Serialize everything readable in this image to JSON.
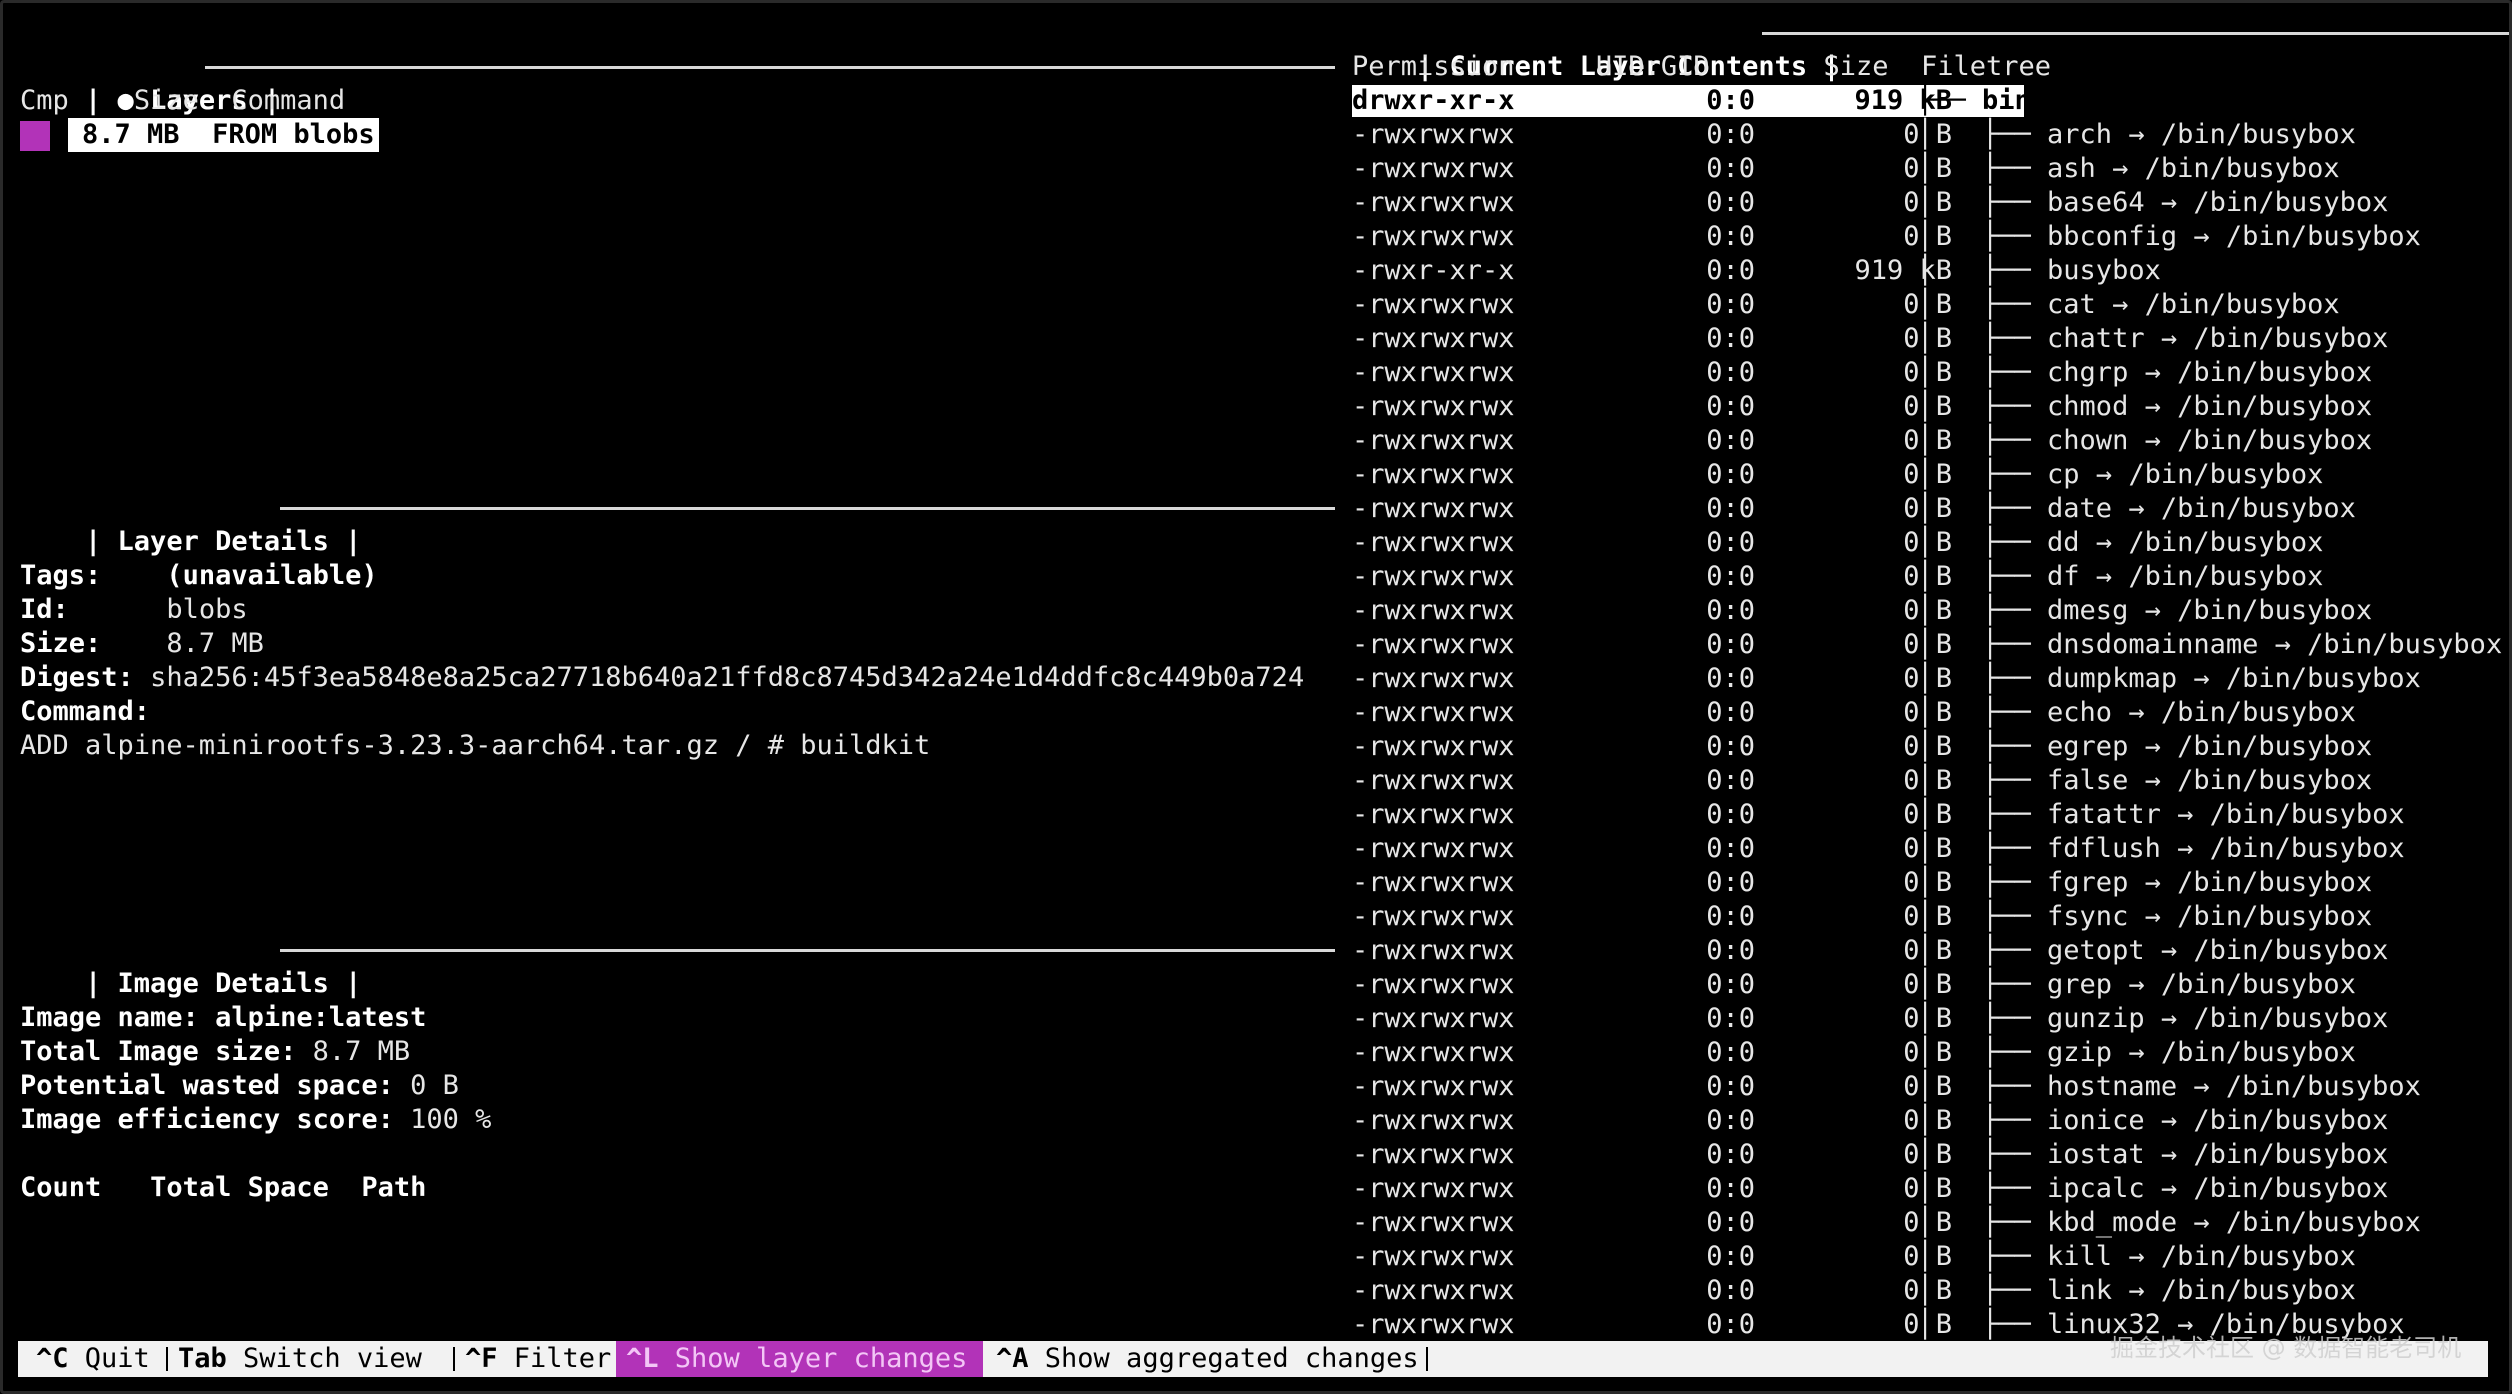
{
  "colors": {
    "background": "#000000",
    "text": "#e6e6e6",
    "layer_swatch": "#b233b8",
    "active_key": "#b233b8",
    "statusbar_bg": "#f2f2f2"
  },
  "layers_pane": {
    "title": "Layers",
    "title_marker": "●",
    "columns": {
      "cmp": "Cmp",
      "size": "Size",
      "command": "Command"
    },
    "rows": [
      {
        "size": "8.7 MB",
        "command": "FROM blobs"
      }
    ]
  },
  "layer_details": {
    "title": "Layer Details",
    "tags_label": "Tags:",
    "tags_value": "(unavailable)",
    "id_label": "Id:",
    "id_value": "blobs",
    "size_label": "Size:",
    "size_value": "8.7 MB",
    "digest_label": "Digest:",
    "digest_value": "sha256:45f3ea5848e8a25ca27718b640a21ffd8c8745d342a24e1d4ddfc8c449b0a724",
    "command_label": "Command:",
    "command_value": "ADD alpine-minirootfs-3.23.3-aarch64.tar.gz / # buildkit"
  },
  "image_details": {
    "title": "Image Details",
    "name_label": "Image name:",
    "name_value": "alpine:latest",
    "total_label": "Total Image size:",
    "total_value": "8.7 MB",
    "wasted_label": "Potential wasted space:",
    "wasted_value": "0 B",
    "efficiency_label": "Image efficiency score:",
    "efficiency_value": "100 %",
    "table_headers": {
      "count": "Count",
      "total_space": "Total Space",
      "path": "Path"
    }
  },
  "contents_pane": {
    "title": "Current Layer Contents",
    "columns": {
      "permission": "Permission",
      "uid_gid": "UID:GID",
      "size": "Size",
      "filetree": "Filetree"
    },
    "rows": [
      {
        "perm": "drwxr-xr-x",
        "uid": "0:0",
        "size": "919 kB",
        "tree": "├── bin"
      },
      {
        "perm": "-rwxrwxrwx",
        "uid": "0:0",
        "size": "0 B",
        "tree": "│   ├── arch → /bin/busybox"
      },
      {
        "perm": "-rwxrwxrwx",
        "uid": "0:0",
        "size": "0 B",
        "tree": "│   ├── ash → /bin/busybox"
      },
      {
        "perm": "-rwxrwxrwx",
        "uid": "0:0",
        "size": "0 B",
        "tree": "│   ├── base64 → /bin/busybox"
      },
      {
        "perm": "-rwxrwxrwx",
        "uid": "0:0",
        "size": "0 B",
        "tree": "│   ├── bbconfig → /bin/busybox"
      },
      {
        "perm": "-rwxr-xr-x",
        "uid": "0:0",
        "size": "919 kB",
        "tree": "│   ├── busybox"
      },
      {
        "perm": "-rwxrwxrwx",
        "uid": "0:0",
        "size": "0 B",
        "tree": "│   ├── cat → /bin/busybox"
      },
      {
        "perm": "-rwxrwxrwx",
        "uid": "0:0",
        "size": "0 B",
        "tree": "│   ├── chattr → /bin/busybox"
      },
      {
        "perm": "-rwxrwxrwx",
        "uid": "0:0",
        "size": "0 B",
        "tree": "│   ├── chgrp → /bin/busybox"
      },
      {
        "perm": "-rwxrwxrwx",
        "uid": "0:0",
        "size": "0 B",
        "tree": "│   ├── chmod → /bin/busybox"
      },
      {
        "perm": "-rwxrwxrwx",
        "uid": "0:0",
        "size": "0 B",
        "tree": "│   ├── chown → /bin/busybox"
      },
      {
        "perm": "-rwxrwxrwx",
        "uid": "0:0",
        "size": "0 B",
        "tree": "│   ├── cp → /bin/busybox"
      },
      {
        "perm": "-rwxrwxrwx",
        "uid": "0:0",
        "size": "0 B",
        "tree": "│   ├── date → /bin/busybox"
      },
      {
        "perm": "-rwxrwxrwx",
        "uid": "0:0",
        "size": "0 B",
        "tree": "│   ├── dd → /bin/busybox"
      },
      {
        "perm": "-rwxrwxrwx",
        "uid": "0:0",
        "size": "0 B",
        "tree": "│   ├── df → /bin/busybox"
      },
      {
        "perm": "-rwxrwxrwx",
        "uid": "0:0",
        "size": "0 B",
        "tree": "│   ├── dmesg → /bin/busybox"
      },
      {
        "perm": "-rwxrwxrwx",
        "uid": "0:0",
        "size": "0 B",
        "tree": "│   ├── dnsdomainname → /bin/busybox"
      },
      {
        "perm": "-rwxrwxrwx",
        "uid": "0:0",
        "size": "0 B",
        "tree": "│   ├── dumpkmap → /bin/busybox"
      },
      {
        "perm": "-rwxrwxrwx",
        "uid": "0:0",
        "size": "0 B",
        "tree": "│   ├── echo → /bin/busybox"
      },
      {
        "perm": "-rwxrwxrwx",
        "uid": "0:0",
        "size": "0 B",
        "tree": "│   ├── egrep → /bin/busybox"
      },
      {
        "perm": "-rwxrwxrwx",
        "uid": "0:0",
        "size": "0 B",
        "tree": "│   ├── false → /bin/busybox"
      },
      {
        "perm": "-rwxrwxrwx",
        "uid": "0:0",
        "size": "0 B",
        "tree": "│   ├── fatattr → /bin/busybox"
      },
      {
        "perm": "-rwxrwxrwx",
        "uid": "0:0",
        "size": "0 B",
        "tree": "│   ├── fdflush → /bin/busybox"
      },
      {
        "perm": "-rwxrwxrwx",
        "uid": "0:0",
        "size": "0 B",
        "tree": "│   ├── fgrep → /bin/busybox"
      },
      {
        "perm": "-rwxrwxrwx",
        "uid": "0:0",
        "size": "0 B",
        "tree": "│   ├── fsync → /bin/busybox"
      },
      {
        "perm": "-rwxrwxrwx",
        "uid": "0:0",
        "size": "0 B",
        "tree": "│   ├── getopt → /bin/busybox"
      },
      {
        "perm": "-rwxrwxrwx",
        "uid": "0:0",
        "size": "0 B",
        "tree": "│   ├── grep → /bin/busybox"
      },
      {
        "perm": "-rwxrwxrwx",
        "uid": "0:0",
        "size": "0 B",
        "tree": "│   ├── gunzip → /bin/busybox"
      },
      {
        "perm": "-rwxrwxrwx",
        "uid": "0:0",
        "size": "0 B",
        "tree": "│   ├── gzip → /bin/busybox"
      },
      {
        "perm": "-rwxrwxrwx",
        "uid": "0:0",
        "size": "0 B",
        "tree": "│   ├── hostname → /bin/busybox"
      },
      {
        "perm": "-rwxrwxrwx",
        "uid": "0:0",
        "size": "0 B",
        "tree": "│   ├── ionice → /bin/busybox"
      },
      {
        "perm": "-rwxrwxrwx",
        "uid": "0:0",
        "size": "0 B",
        "tree": "│   ├── iostat → /bin/busybox"
      },
      {
        "perm": "-rwxrwxrwx",
        "uid": "0:0",
        "size": "0 B",
        "tree": "│   ├── ipcalc → /bin/busybox"
      },
      {
        "perm": "-rwxrwxrwx",
        "uid": "0:0",
        "size": "0 B",
        "tree": "│   ├── kbd_mode → /bin/busybox"
      },
      {
        "perm": "-rwxrwxrwx",
        "uid": "0:0",
        "size": "0 B",
        "tree": "│   ├── kill → /bin/busybox"
      },
      {
        "perm": "-rwxrwxrwx",
        "uid": "0:0",
        "size": "0 B",
        "tree": "│   ├── link → /bin/busybox"
      },
      {
        "perm": "-rwxrwxrwx",
        "uid": "0:0",
        "size": "0 B",
        "tree": "│   ├── linux32 → /bin/busybox"
      }
    ]
  },
  "statusbar": {
    "quit_key": "^C",
    "quit_label": "Quit",
    "switch_key": "Tab",
    "switch_label": "Switch view",
    "filter_key": "^F",
    "filter_label": "Filter",
    "layer_changes_key": "^L",
    "layer_changes_label": "Show layer changes",
    "aggregated_key": "^A",
    "aggregated_label": "Show aggregated changes"
  },
  "watermark": "掘金技术社区 @ 数据智能老司机"
}
